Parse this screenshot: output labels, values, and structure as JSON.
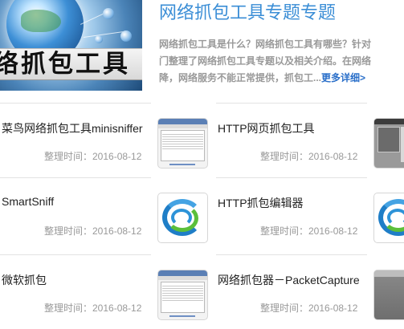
{
  "banner": {
    "image_caption": "络抓包工具",
    "title": "网络抓包工具专题专题",
    "description_lines": [
      "网络抓包工具是什么？网络抓包工具有哪些？针对",
      "门整理了网络抓包工具专题以及相关介绍。在网络",
      "降，网络服务不能正常提供，抓包工..."
    ],
    "more_link": "更多详细>"
  },
  "items": [
    {
      "title": "菜鸟网络抓包工具minisniffer",
      "date": "整理时间：2016-08-12",
      "thumb": "window-screenshot"
    },
    {
      "title": "HTTP网页抓包工具",
      "date": "整理时间：2016-08-12",
      "thumb": "window-screenshot"
    },
    {
      "title": "",
      "date": "",
      "thumb": "dark-program-screenshot"
    },
    {
      "title": "SmartSniff",
      "date": "整理时间：2016-08-12",
      "thumb": "swirl-logo"
    },
    {
      "title": "HTTP抓包编辑器",
      "date": "整理时间：2016-08-12",
      "thumb": "swirl-logo"
    },
    {
      "title": "",
      "date": "",
      "thumb": "swirl-logo"
    },
    {
      "title": "微软抓包",
      "date": "整理时间：2016-08-12",
      "thumb": "window-screenshot"
    },
    {
      "title": "网络抓包器－PacketCapture",
      "date": "整理时间：2016-08-12",
      "thumb": "window-screenshot"
    },
    {
      "title": "",
      "date": "",
      "thumb": "grey-program-screenshot"
    }
  ]
}
